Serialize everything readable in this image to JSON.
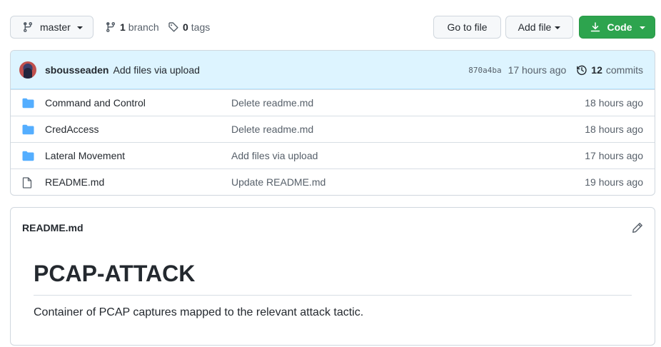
{
  "topbar": {
    "branch_name": "master",
    "branch_count": "1",
    "branch_label": "branch",
    "tag_count": "0",
    "tag_label": "tags",
    "goto_file": "Go to file",
    "add_file": "Add file",
    "code": "Code"
  },
  "commit": {
    "author": "sbousseaden",
    "message": "Add files via upload",
    "sha": "870a4ba",
    "time": "17 hours ago",
    "commit_count": "12",
    "commit_label": "commits"
  },
  "files": [
    {
      "icon": "folder-icon",
      "name": "Command and Control",
      "message": "Delete readme.md",
      "time": "18 hours ago"
    },
    {
      "icon": "folder-icon",
      "name": "CredAccess",
      "message": "Delete readme.md",
      "time": "18 hours ago"
    },
    {
      "icon": "folder-icon",
      "name": "Lateral Movement",
      "message": "Add files via upload",
      "time": "17 hours ago"
    },
    {
      "icon": "file-icon",
      "name": "README.md",
      "message": "Update README.md",
      "time": "19 hours ago"
    }
  ],
  "readme": {
    "title": "README.md",
    "heading": "PCAP-ATTACK",
    "paragraph": "Container of PCAP captures mapped to the relevant attack tactic."
  },
  "colors": {
    "folder": "#54aeff",
    "code_button": "#2da44e",
    "commit_bar": "#ddf4ff"
  }
}
